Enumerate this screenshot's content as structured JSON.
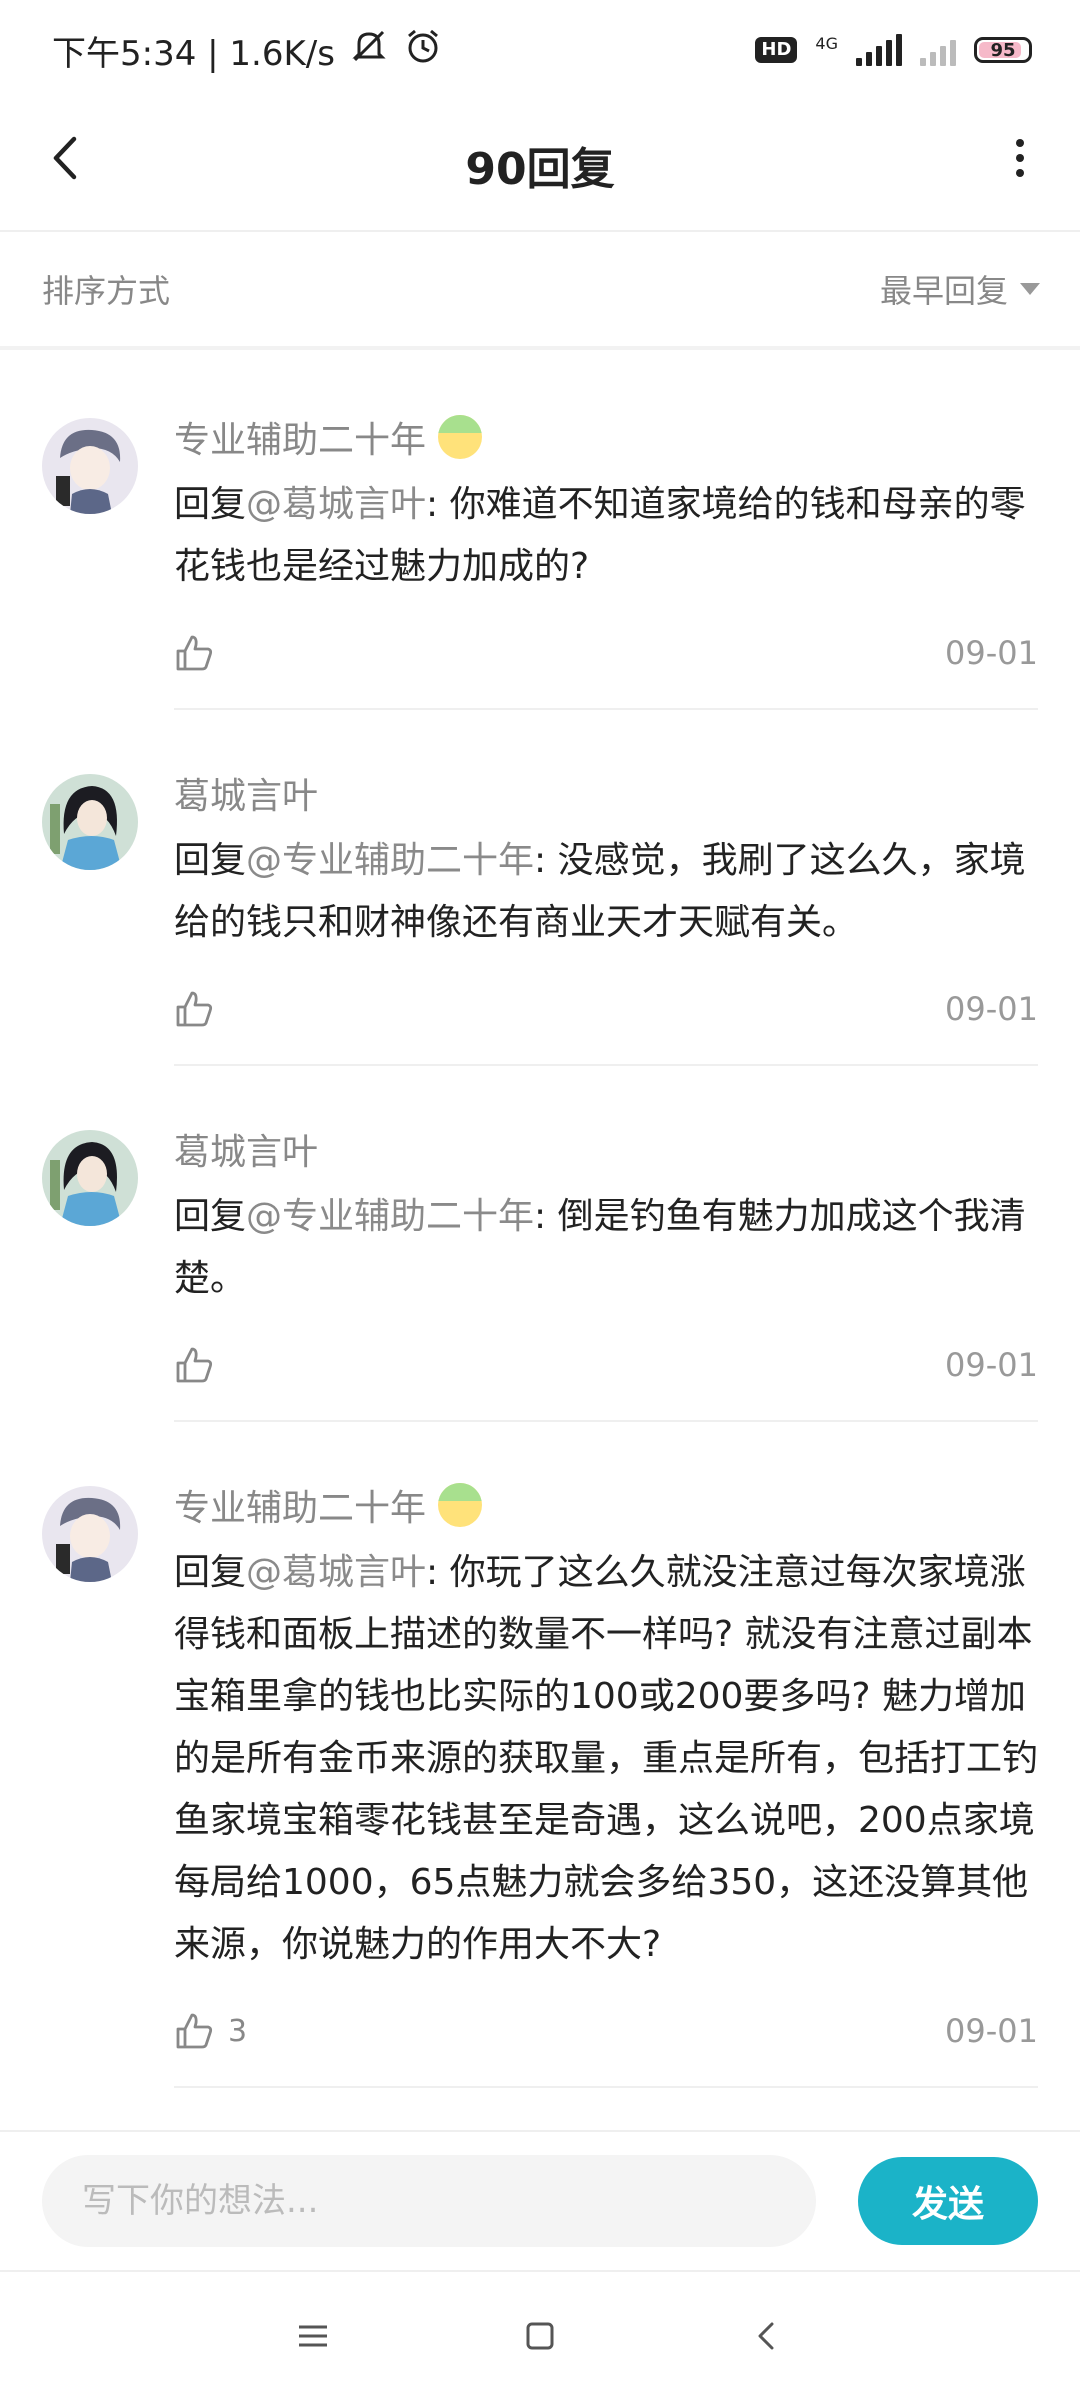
{
  "status_bar": {
    "time": "下午5:34 | 1.6K/s",
    "hd": "HD",
    "network": "4G",
    "battery": "95",
    "icons": [
      "mute-icon",
      "alarm-icon",
      "signal-icon",
      "battery-icon"
    ]
  },
  "header": {
    "title": "90回复",
    "icons": [
      "back-icon",
      "more-icon"
    ]
  },
  "sort": {
    "label": "排序方式",
    "value": "最早回复"
  },
  "comments": [
    {
      "author": "专业辅助二十年",
      "has_badge": true,
      "reply_prefix": "回复",
      "mention": "@葛城言叶",
      "text": ": 你难道不知道家境给的钱和母亲的零花钱也是经过魅力加成的?",
      "likes": "",
      "date": "09-01"
    },
    {
      "author": "葛城言叶",
      "has_badge": false,
      "reply_prefix": "回复",
      "mention": "@专业辅助二十年",
      "text": ": 没感觉，我刷了这么久，家境给的钱只和财神像还有商业天才天赋有关。",
      "likes": "",
      "date": "09-01"
    },
    {
      "author": "葛城言叶",
      "has_badge": false,
      "reply_prefix": "回复",
      "mention": "@专业辅助二十年",
      "text": ": 倒是钓鱼有魅力加成这个我清楚。",
      "likes": "",
      "date": "09-01"
    },
    {
      "author": "专业辅助二十年",
      "has_badge": true,
      "reply_prefix": "回复",
      "mention": "@葛城言叶",
      "text": ": 你玩了这么久就没注意过每次家境涨得钱和面板上描述的数量不一样吗? 就没有注意过副本宝箱里拿的钱也比实际的100或200要多吗? 魅力增加的是所有金币来源的获取量，重点是所有，包括打工钓鱼家境宝箱零花钱甚至是奇遇，这么说吧，200点家境每局给1000，65点魅力就会多给350，这还没算其他来源，你说魅力的作用大不大?",
      "likes": "3",
      "date": "09-01"
    }
  ],
  "input": {
    "placeholder": "写下你的想法...",
    "send_label": "发送"
  },
  "colors": {
    "accent": "#1bb3c8",
    "secondary_text": "#888888"
  }
}
